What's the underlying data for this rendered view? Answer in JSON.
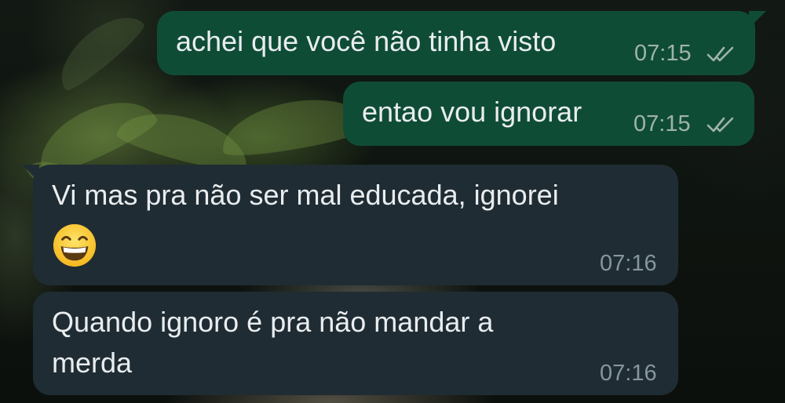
{
  "chat": {
    "messages": [
      {
        "direction": "outgoing",
        "text": "achei que você não tinha visto",
        "time": "07:15",
        "status": "read"
      },
      {
        "direction": "outgoing",
        "text": "entao vou ignorar",
        "time": "07:15",
        "status": "read"
      },
      {
        "direction": "incoming",
        "text_line1": "Vi mas pra não ser mal educada, ignorei",
        "emoji": "grinning-face-with-smiling-eyes",
        "time": "07:16"
      },
      {
        "direction": "incoming",
        "text_line1": "Quando ignoro é pra não mandar a",
        "text_line2": "merda",
        "time": "07:16"
      }
    ]
  },
  "colors": {
    "outgoing_bubble": "#0f4c36",
    "incoming_bubble": "#1f2c33",
    "text": "#e9edef",
    "read_tick": "#9fb3ad"
  },
  "icons": {
    "status_read": "double-check-icon"
  }
}
